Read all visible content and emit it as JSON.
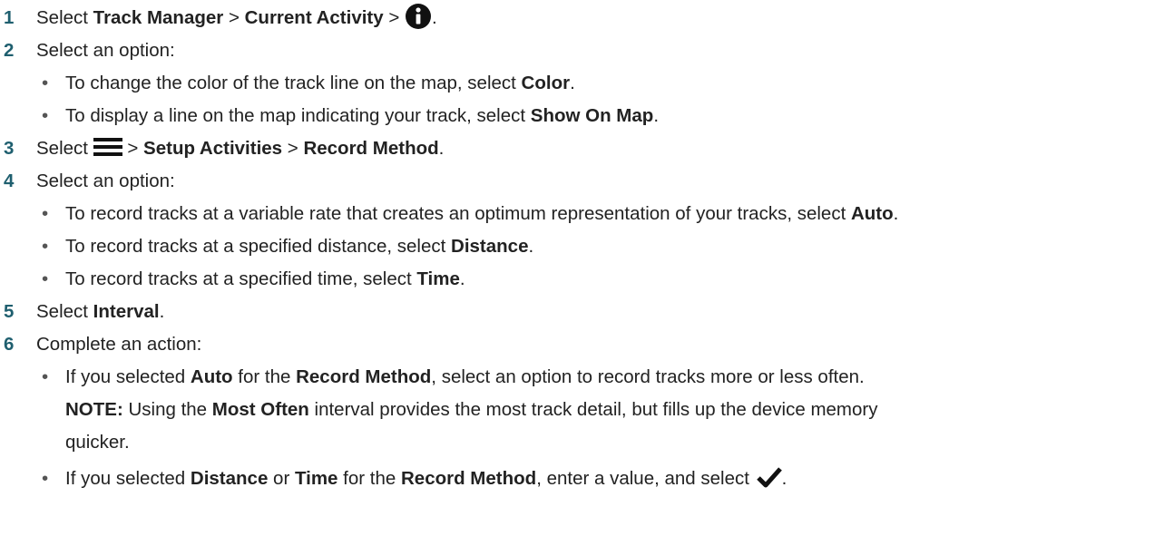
{
  "steps": [
    {
      "num": "1",
      "segs": [
        "Select ",
        "Track Manager",
        " > ",
        "Current Activity",
        " > ",
        "."
      ]
    },
    {
      "num": "2",
      "text": "Select an option:"
    },
    {
      "num": "3",
      "segs": [
        "Select ",
        " > ",
        "Setup Activities",
        " > ",
        "Record Method",
        "."
      ]
    },
    {
      "num": "4",
      "text": "Select an option:"
    },
    {
      "num": "5",
      "segs": [
        "Select ",
        "Interval",
        "."
      ]
    },
    {
      "num": "6",
      "text": "Complete an action:"
    }
  ],
  "step2_options": [
    {
      "segs": [
        "To change the color of the track line on the map, select ",
        "Color",
        "."
      ]
    },
    {
      "segs": [
        "To display a line on the map indicating your track, select ",
        "Show On Map",
        "."
      ]
    }
  ],
  "step4_options": [
    {
      "segs": [
        "To record tracks at a variable rate that creates an optimum representation of your tracks, select ",
        "Auto",
        "."
      ]
    },
    {
      "segs": [
        "To record tracks at a specified distance, select ",
        "Distance",
        "."
      ]
    },
    {
      "segs": [
        "To record tracks at a specified time, select ",
        "Time",
        "."
      ]
    }
  ],
  "step6_options": [
    {
      "segs": [
        "If you selected ",
        "Auto",
        " for the ",
        "Record Method",
        ", select an option to record tracks more or less often."
      ]
    },
    {
      "segs": [
        "If you selected ",
        "Distance",
        " or ",
        "Time",
        " for the ",
        "Record Method",
        ", enter a value, and select ",
        "."
      ]
    }
  ],
  "note": {
    "segs": [
      "NOTE:",
      " Using the ",
      "Most Often",
      " interval provides the most track detail, but fills up the device memory",
      "quicker."
    ]
  },
  "bullet": "•",
  "icons": {
    "info": "info-circle-icon",
    "menu": "hamburger-menu-icon",
    "check": "checkmark-icon"
  },
  "colors": {
    "text": "#222222",
    "step_number": "#1f5f6f",
    "icon": "#111111"
  }
}
